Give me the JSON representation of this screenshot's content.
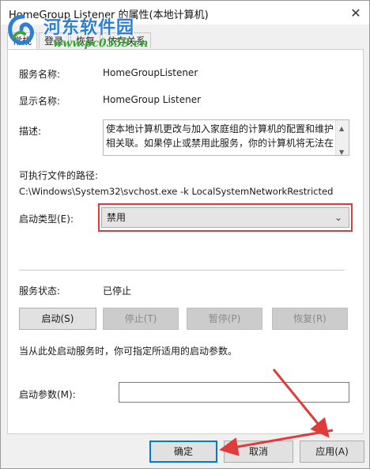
{
  "window": {
    "title": "HomeGroup Listener 的属性(本地计算机)",
    "close_glyph": "✕"
  },
  "watermark": {
    "title": "河东软件园",
    "url": "www.pc0359.cn"
  },
  "tabs": [
    {
      "label": "常规"
    },
    {
      "label": "登录"
    },
    {
      "label": "恢复"
    },
    {
      "label": "依存关系"
    }
  ],
  "general": {
    "service_name_label": "服务名称:",
    "service_name_value": "HomeGroupListener",
    "display_name_label": "显示名称:",
    "display_name_value": "HomeGroup Listener",
    "description_label": "描述:",
    "description_value": "使本地计算机更改与加入家庭组的计算机的配置和维护相关联。如果停止或禁用此服务，你的计算机将无法在",
    "exe_path_label": "可执行文件的路径:",
    "exe_path_value": "C:\\Windows\\System32\\svchost.exe -k LocalSystemNetworkRestricted",
    "startup_type_label": "启动类型(E):",
    "startup_type_value": "禁用",
    "service_status_label": "服务状态:",
    "service_status_value": "已停止",
    "start_button": "启动(S)",
    "stop_button": "停止(T)",
    "pause_button": "暂停(P)",
    "resume_button": "恢复(R)",
    "hint_text": "当从此处启动服务时，你可指定所适用的启动参数。",
    "start_params_label": "启动参数(M):",
    "start_params_value": ""
  },
  "footer": {
    "ok_button": "确定",
    "cancel_button": "取消",
    "apply_button": "应用(A)"
  },
  "colors": {
    "annotation_red": "#e03b3b",
    "focus_blue": "#0078d7"
  }
}
